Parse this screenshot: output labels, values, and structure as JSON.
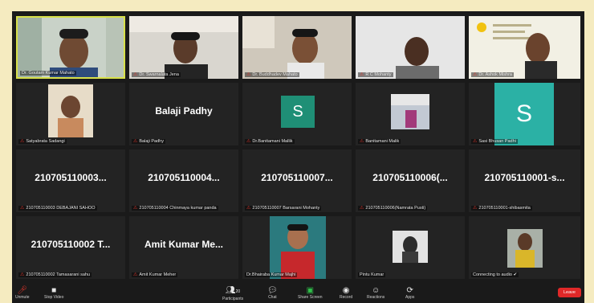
{
  "participants": [
    {
      "name": "Dr. Goutam Kumar Mahato",
      "active": true
    },
    {
      "name": "Dr. Swarnalata Jena"
    },
    {
      "name": "Dr. Buddhadev Mahato"
    },
    {
      "name": "R C Mohanty"
    },
    {
      "name": "Dr. Ashok Mishra"
    },
    {
      "name": "Satyabrata Sadangi"
    },
    {
      "name": "Balaji Padhy",
      "display": "Balaji Padhy"
    },
    {
      "name": "Dr.Banitamani Mallik",
      "avatar": "S",
      "avatar_color": "#1f8f76"
    },
    {
      "name": "Banitamani Malik"
    },
    {
      "name": "Sasi Bhusan Padhi",
      "avatar": "S",
      "avatar_color": "#2bb1a5"
    },
    {
      "name": "210705110003 DEBAJANI SAHOO",
      "display": "210705110003..."
    },
    {
      "name": "210705110004 Chinmaya kumar panda",
      "display": "210705110004..."
    },
    {
      "name": "210705110007 Barsarani Mohanty",
      "display": "210705110007..."
    },
    {
      "name": "210705110006(Namrata Pusti)",
      "display": "210705110006(..."
    },
    {
      "name": "210705110001-shibasmita",
      "display": "210705110001-s..."
    },
    {
      "name": "210705110002 Tamasarani sahu",
      "display": "210705110002 T..."
    },
    {
      "name": "Amit Kumar Meher",
      "display": "Amit Kumar Me..."
    },
    {
      "name": "Dr.Bhairaba Kumar Majhi"
    },
    {
      "name": "Pintu Kumar"
    },
    {
      "name": "Connecting to audio ✔"
    }
  ],
  "toolbar": {
    "unmute": "Unmute",
    "stop_video": "Stop Video",
    "participants": "Participants",
    "participants_count": "20",
    "chat": "Chat",
    "share_screen": "Share Screen",
    "record": "Record",
    "reactions": "Reactions",
    "apps": "Apps",
    "leave": "Leave"
  },
  "colors": {
    "active_border": "#d8e04a",
    "leave": "#e02828",
    "mic_muted": "#e0352b"
  }
}
